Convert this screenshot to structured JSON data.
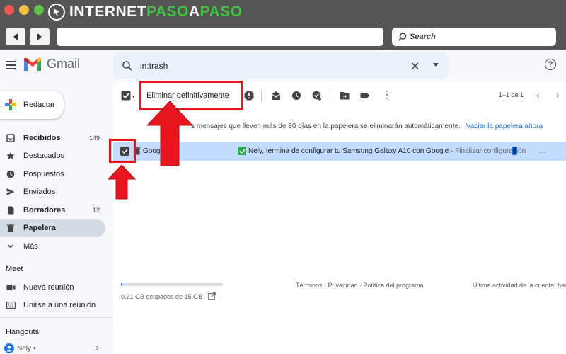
{
  "brand": {
    "part1": "INTERNET",
    "part2": "PASO",
    "part3": "A",
    "part4": "PASO"
  },
  "browser": {
    "search_placeholder": "Search"
  },
  "gmail": {
    "app_name": "Gmail",
    "search_query": "in:trash",
    "compose_label": "Redactar",
    "nav": [
      {
        "label": "Recibidos",
        "count": "149",
        "bold": true,
        "icon": "inbox-icon"
      },
      {
        "label": "Destacados",
        "count": "",
        "bold": false,
        "icon": "star-icon"
      },
      {
        "label": "Pospuestos",
        "count": "",
        "bold": false,
        "icon": "clock-icon"
      },
      {
        "label": "Enviados",
        "count": "",
        "bold": false,
        "icon": "send-icon"
      },
      {
        "label": "Borradores",
        "count": "12",
        "bold": true,
        "icon": "draft-icon"
      },
      {
        "label": "Papelera",
        "count": "",
        "bold": true,
        "icon": "trash-icon"
      },
      {
        "label": "Más",
        "count": "",
        "bold": false,
        "icon": "chevron-down-icon"
      }
    ],
    "meet": {
      "heading": "Meet",
      "items": [
        {
          "label": "Nueva reunión",
          "icon": "video-icon"
        },
        {
          "label": "Unirse a una reunión",
          "icon": "keyboard-icon"
        }
      ]
    },
    "hangouts": {
      "heading": "Hangouts",
      "user": "Nely"
    },
    "toolbar": {
      "delete_forever_label": "Eliminar definitivamente",
      "pager_text": "1–1 de 1"
    },
    "banner": {
      "text": "Se eliminarán automáticamente los mensajes que lleven más de 30 días en la papelera",
      "visible_text": "s mensajes que lleven más de 30 días en la papelera se eliminarán automáticamente.",
      "link": "Vaciar la papelera ahora"
    },
    "messages": [
      {
        "sender": "Google",
        "subject": "Nely, termina de configurar tu Samsung Galaxy A10 con Google",
        "snippet": " - Finalizar configuración ",
        "selected": true
      }
    ],
    "footer": {
      "storage": "0,21 GB ocupados de 15 GB",
      "storage_fraction": 0.014,
      "links": "Términos · Privacidad · Política del programa",
      "activity": "Última actividad de la cuenta: hace"
    }
  },
  "colors": {
    "annotation_red": "#e8141e",
    "selected_row": "#c2dbff",
    "link_blue": "#1a73e8"
  }
}
